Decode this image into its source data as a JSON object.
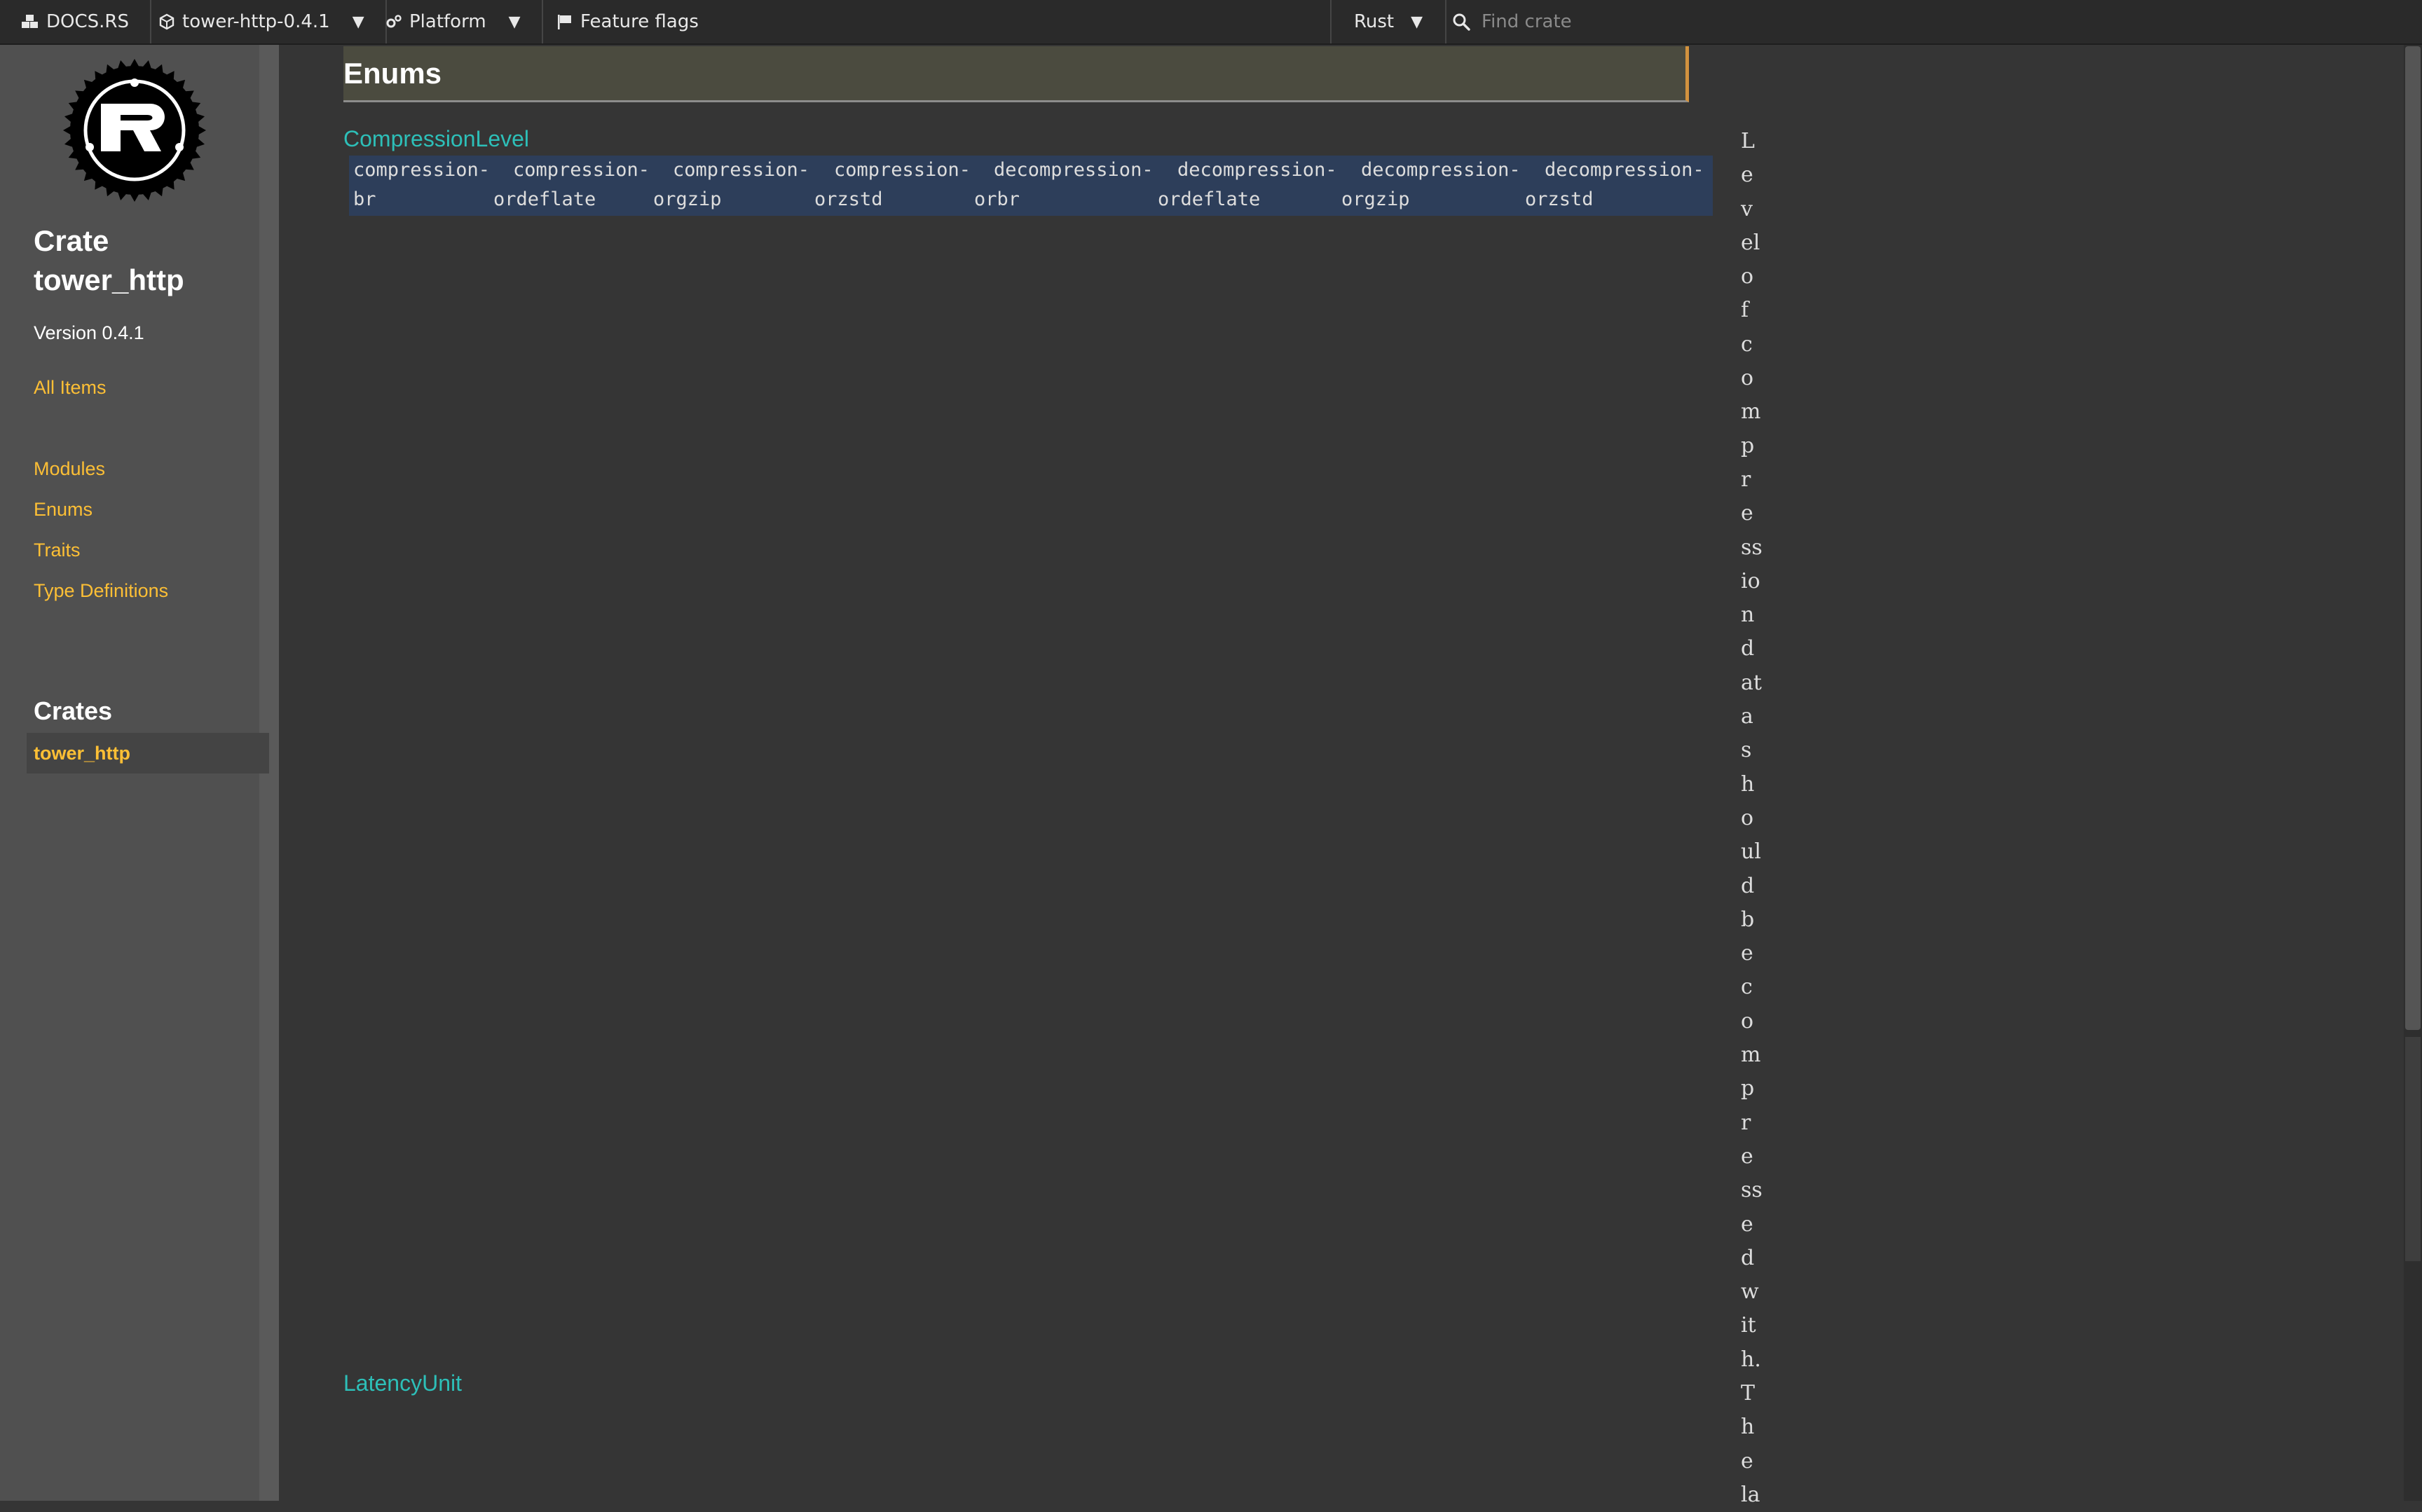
{
  "topnav": {
    "logo_label": "DOCS.RS",
    "crate_label": "tower-http-0.4.1",
    "platform_label": "Platform",
    "feature_flags_label": "Feature flags",
    "rust_label": "Rust",
    "search_placeholder": "Find crate"
  },
  "sidebar": {
    "crate_prefix": "Crate",
    "crate_name": "tower_http",
    "version": "Version 0.4.1",
    "all_items": "All Items",
    "links": [
      "Modules",
      "Enums",
      "Traits",
      "Type Definitions"
    ],
    "crates_heading": "Crates",
    "current_crate": "tower_http"
  },
  "main": {
    "section_title": "Enums",
    "items": [
      {
        "name": "CompressionLevel",
        "tags": [
          {
            "top": "compression-",
            "bottom": "br"
          },
          {
            "top": "compression-",
            "bottom": "ordeflate"
          },
          {
            "top": "compression-",
            "bottom": "orgzip"
          },
          {
            "top": "compression-",
            "bottom": "orzstd"
          },
          {
            "top": "decompression-",
            "bottom": "orbr"
          },
          {
            "top": "decompression-",
            "bottom": "ordeflate"
          },
          {
            "top": "decompression-",
            "bottom": "orgzip"
          },
          {
            "top": "decompression-",
            "bottom": "orzstd"
          }
        ],
        "description_fragments": [
          "L",
          "e",
          "v",
          "el",
          "o",
          "f",
          "c",
          "o",
          "m",
          "p",
          "r",
          "e",
          "ss",
          "io",
          "n",
          "d",
          "at",
          "a",
          "s",
          "h",
          "o",
          "ul",
          "d",
          "b",
          "e",
          "c",
          "o",
          "m",
          "p",
          "r",
          "e",
          "ss",
          "e",
          "d",
          "w",
          "it",
          "h.",
          "T",
          "h",
          "e",
          "la"
        ]
      },
      {
        "name": "LatencyUnit"
      }
    ]
  },
  "colors": {
    "link_yellow": "#fdbf35",
    "link_teal": "#2dbfb8",
    "header_accent": "#d2923e"
  }
}
